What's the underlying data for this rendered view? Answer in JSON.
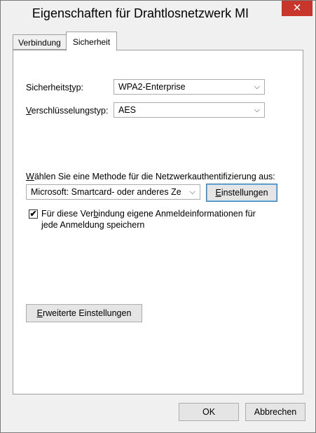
{
  "window": {
    "title": "Eigenschaften für Drahtlosnetzwerk MI",
    "close_glyph": "✕"
  },
  "tabs": [
    {
      "label": "Verbindung",
      "active": false
    },
    {
      "label": "Sicherheit",
      "active": true
    }
  ],
  "security": {
    "type_label_pre": "Sicherheits",
    "type_label_u": "t",
    "type_label_post": "yp:",
    "type_value": "WPA2-Enterprise",
    "encryption_label_pre": "",
    "encryption_label_u": "V",
    "encryption_label_post": "erschlüsselungstyp:",
    "encryption_value": "AES"
  },
  "auth": {
    "label_pre": "",
    "label_u": "W",
    "label_post": "ählen Sie eine Methode für die Netzwerkauthentifizierung aus:",
    "method_value": "Microsoft: Smartcard- oder anderes Ze",
    "settings_pre": "",
    "settings_u": "E",
    "settings_post": "instellungen"
  },
  "remember": {
    "checked": true,
    "check_glyph": "✔",
    "line1_pre": "Für diese Ver",
    "line1_u": "b",
    "line1_post": "indung eigene Anmeldeinformationen für",
    "line2": "jede Anmeldung speichern"
  },
  "advanced": {
    "pre": "",
    "u": "E",
    "post": "rweiterte Einstellungen"
  },
  "footer": {
    "ok_label": "OK",
    "cancel_label": "Abbrechen"
  },
  "icons": {
    "chevron": "chevron-down-icon",
    "check": "checkmark-icon",
    "close": "close-icon"
  }
}
